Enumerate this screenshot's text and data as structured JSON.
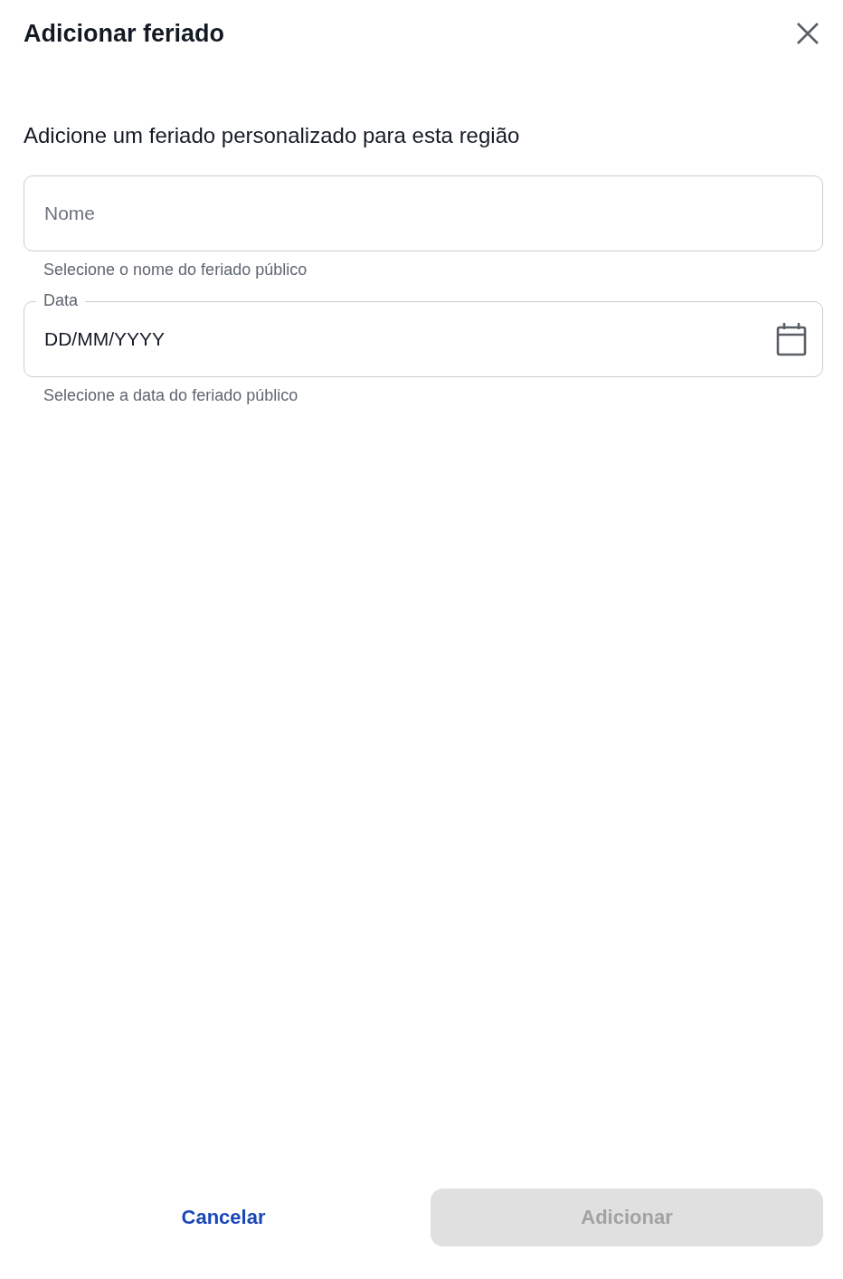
{
  "dialog": {
    "title": "Adicionar feriado",
    "subtitle": "Adicione um feriado personalizado para esta região"
  },
  "fields": [
    {
      "kind": "text",
      "placeholder": "Nome",
      "helper": "Selecione o nome do feriado público"
    },
    {
      "kind": "date",
      "label": "Data",
      "placeholder": "DD/MM/YYYY",
      "helper": "Selecione a data do feriado público"
    }
  ],
  "buttons": [
    {
      "kind": "text",
      "label": "Cancelar",
      "disabled": false
    },
    {
      "kind": "contained",
      "label": "Adicionar",
      "disabled": true
    }
  ]
}
